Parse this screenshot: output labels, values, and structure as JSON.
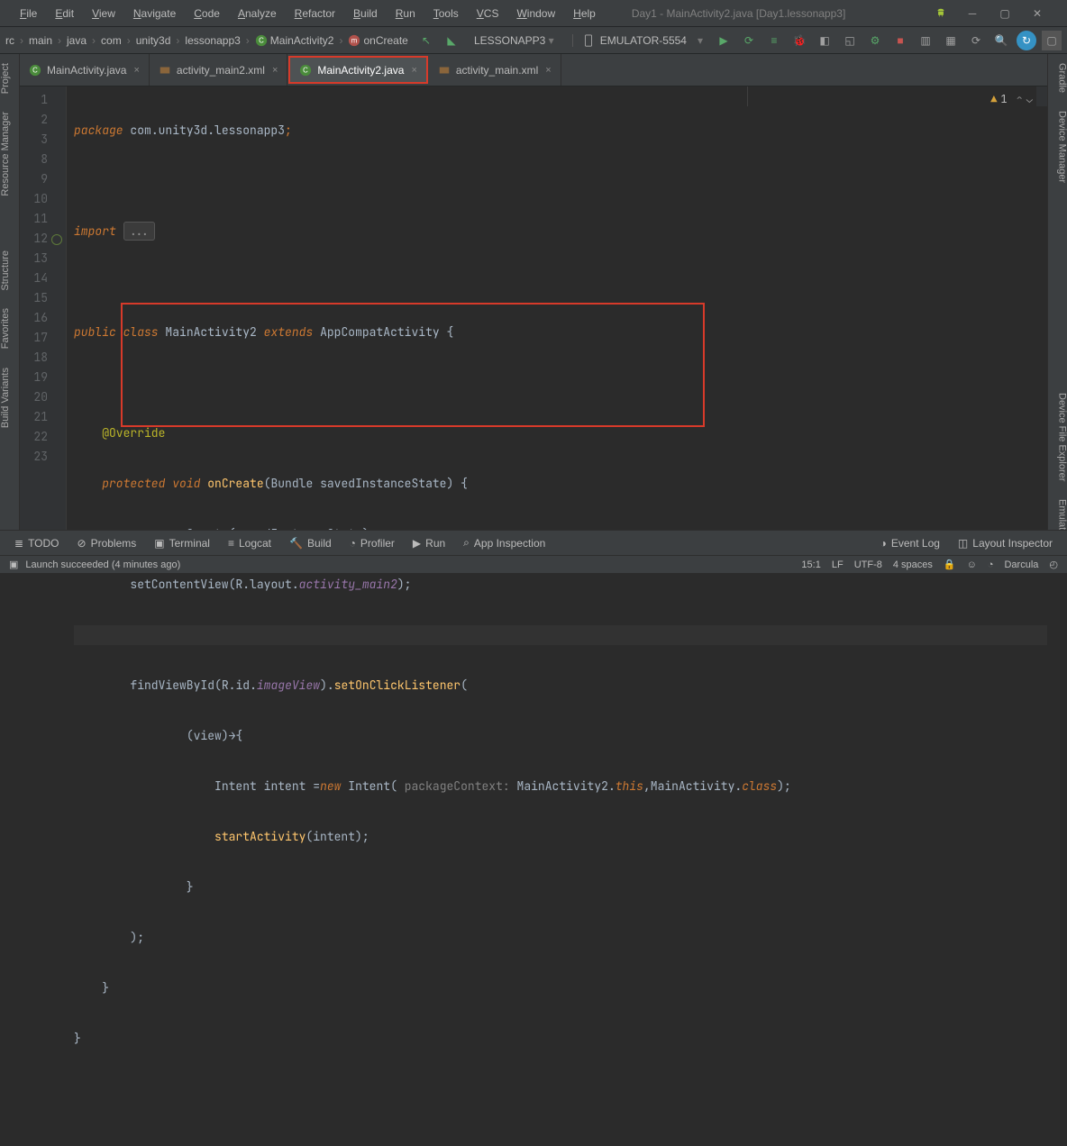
{
  "window": {
    "title": "Day1 - MainActivity2.java [Day1.lessonapp3]"
  },
  "menu": [
    "File",
    "Edit",
    "View",
    "Navigate",
    "Code",
    "Analyze",
    "Refactor",
    "Build",
    "Run",
    "Tools",
    "VCS",
    "Window",
    "Help"
  ],
  "breadcrumbs": [
    "rc",
    "main",
    "java",
    "com",
    "unity3d",
    "lessonapp3",
    "MainActivity2",
    "onCreate"
  ],
  "run_config": "LESSONAPP3",
  "device": "EMULATOR-5554",
  "left_tools": [
    "Project",
    "Resource Manager",
    "Structure",
    "Favorites",
    "Build Variants"
  ],
  "right_tools": [
    "Gradle",
    "Device Manager",
    "Device File Explorer",
    "Emulator"
  ],
  "tabs": [
    {
      "name": "MainActivity.java",
      "type": "java",
      "active": false
    },
    {
      "name": "activity_main2.xml",
      "type": "xml",
      "active": false
    },
    {
      "name": "MainActivity2.java",
      "type": "java",
      "active": true,
      "highlighted": true
    },
    {
      "name": "activity_main.xml",
      "type": "xml",
      "active": false
    }
  ],
  "code": {
    "lines": [
      1,
      2,
      3,
      8,
      9,
      10,
      11,
      12,
      13,
      14,
      15,
      16,
      17,
      18,
      19,
      20,
      21,
      22,
      23
    ],
    "package": "com.unity3d.lessonapp3",
    "import_folded": "...",
    "class_decl": {
      "modifiers": "public class",
      "name": "MainActivity2",
      "extends": "extends",
      "super": "AppCompatActivity"
    },
    "override": "@Override",
    "oncreate_sig": {
      "modifiers": "protected",
      "ret": "void",
      "name": "onCreate",
      "param_type": "Bundle",
      "param_name": "savedInstanceState"
    },
    "super_call": {
      "target": "super",
      "method": "onCreate",
      "arg": "savedInstanceState"
    },
    "setcontent": {
      "method": "setContentView",
      "r": "R",
      "layout": "layout",
      "res": "activity_main2"
    },
    "findview": {
      "method": "findViewById",
      "r": "R",
      "id": "id",
      "res": "imageView",
      "setter": "setOnClickListener"
    },
    "lambda_param": "(view)",
    "lambda_arrow": "→{",
    "intent_line": {
      "type": "Intent",
      "var": "intent",
      "new": "new",
      "ctor": "Intent",
      "hint": "packageContext:",
      "owner": "MainActivity2",
      "thisref": "this",
      "target": "MainActivity",
      "classkw": "class"
    },
    "start": {
      "method": "startActivity",
      "arg": "intent"
    }
  },
  "inspect": {
    "warnings": "1"
  },
  "bottom_tabs": [
    "TODO",
    "Problems",
    "Terminal",
    "Logcat",
    "Build",
    "Profiler",
    "Run",
    "App Inspection"
  ],
  "bottom_right": [
    "Event Log",
    "Layout Inspector"
  ],
  "status": {
    "message": "Launch succeeded (4 minutes ago)",
    "pos": "15:1",
    "eol": "LF",
    "enc": "UTF-8",
    "indent": "4 spaces",
    "theme": "Darcula"
  }
}
